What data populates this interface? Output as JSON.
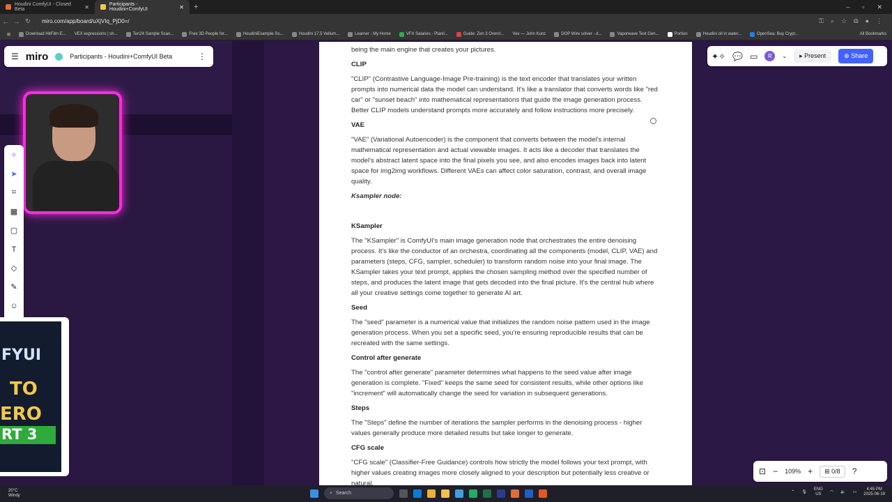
{
  "browser": {
    "tabs": [
      {
        "title": "Houdini ComfyUI - Closed Beta",
        "color": "#e06c3c",
        "active": false
      },
      {
        "title": "Participants - Houdini+ComfyUI",
        "color": "#f2c94c",
        "active": true
      }
    ],
    "url": "miro.com/app/board/uXjVIq_PjD0=/",
    "bookmarks": [
      "Download HitFilm E...",
      "VEX expressions | sh...",
      "Ten24 Sample Scan...",
      "Free 3D People for...",
      "HoudiniExample-So...",
      "Houdini 17.5 Vellum...",
      "Learner - My Home",
      "VFX Salaries - Planil...",
      "Guide: Zen 3 Overcl...",
      "Vex — John Kunz",
      "DOP Wire solver - d...",
      "Vaporwave Text Gen...",
      "Portion",
      "Houdini oil in water...",
      "OpenSea: Buy Crypt...",
      "All Bookmarks"
    ]
  },
  "miro": {
    "logo": "miro",
    "board_title": "Participants - Houdini+ComfyUI Beta",
    "present_label": "Present",
    "share_label": "Share",
    "avatar_initial": "R",
    "zoom": "109%",
    "pages": "0/8"
  },
  "doc": {
    "lead": "being the main engine that creates your pictures.",
    "sections": [
      {
        "h": "CLIP",
        "p": "\"CLIP\" (Contrastive Language-Image Pre-training) is the text encoder that translates your written prompts into numerical data the model can understand. It's like a translator that converts words like \"red car\" or \"sunset beach\" into mathematical representations that guide the image generation process. Better CLIP models understand prompts more accurately and follow instructions more precisely."
      },
      {
        "h": "VAE",
        "p": "\"VAE\" (Variational Autoencoder) is the component that converts between the model's internal mathematical representation and actual viewable images. It acts like a decoder that translates the model's abstract latent space into the final pixels you see, and also encodes images back into latent space for img2img workflows. Different VAEs can affect color saturation, contrast, and overall image quality."
      }
    ],
    "ksampler_node": "Ksampler node:",
    "sections2": [
      {
        "h": "KSampler",
        "p": "The \"KSampler\" is ComfyUI's main image generation node that orchestrates the entire denoising process. It's like the conductor of an orchestra, coordinating all the components (model, CLIP, VAE) and parameters (steps, CFG, sampler, scheduler) to transform random noise into your final image. The KSampler takes your text prompt, applies the chosen sampling method over the specified number of steps, and produces the latent image that gets decoded into the final picture. It's the central hub where all your creative settings come together to generate AI art."
      },
      {
        "h": "Seed",
        "p": "The \"seed\" parameter is a numerical value that initializes the random noise pattern used in the image generation process. When you set a specific seed, you're ensuring reproducible results that can be recreated with the same settings."
      },
      {
        "h": "Control after generate",
        "p": "The \"control after generate\" parameter determines what happens to the seed value after image generation is complete. \"Fixed\" keeps the same seed for consistent results, while other options like \"increment\" will automatically change the seed for variation in subsequent generations."
      },
      {
        "h": "Steps",
        "p": "The \"Steps\" define the number of iterations the sampler performs in the denoising process - higher values generally produce more detailed results but take longer to generate."
      },
      {
        "h": "CFG scale",
        "p": "\"CFG scale\" (Classifier-Free Guidance) controls how strictly the model follows your text prompt, with higher values creating images more closely aligned to your description but potentially less creative or natural."
      }
    ]
  },
  "thumbnail": {
    "lines": [
      "FYUI",
      "TO",
      "ERO",
      "RT 3"
    ]
  },
  "taskbar": {
    "weather_temp": "20°C",
    "weather_desc": "Windy",
    "search_placeholder": "Search",
    "lang": "ENG",
    "region": "US",
    "time": "4:45 PM",
    "date": "2025-06-19"
  }
}
